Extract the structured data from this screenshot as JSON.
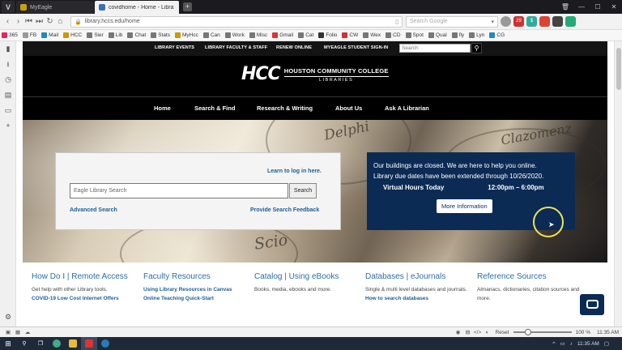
{
  "browser": {
    "tabs": [
      {
        "label": "MyEagle",
        "active": false
      },
      {
        "label": "covidhome - Home - Libra",
        "active": true
      }
    ],
    "url": "library.hccs.edu/home",
    "search_placeholder": "Search Google",
    "bookmarks": [
      "365",
      "FB",
      "Mail",
      "HCC",
      "Sier",
      "Lib",
      "Chat",
      "Stats",
      "MyHcc",
      "Can",
      "Work",
      "Misc",
      "Gmail",
      "Cat",
      "Folio",
      "CW",
      "Wex",
      "CD",
      "Spot",
      "Qual",
      "fly",
      "Lyn",
      "CG"
    ],
    "zoom_reset_label": "Reset",
    "zoom_level": "100 %",
    "status_time": "11:35 AM",
    "taskbar_time": "11:35 AM"
  },
  "site": {
    "utility_links": [
      "LIBRARY EVENTS",
      "LIBRARY FACULTY & STAFF",
      "RENEW ONLINE",
      "MYEAGLE STUDENT SIGN-IN"
    ],
    "utility_search_placeholder": "Search",
    "logo": {
      "mark": "HCC",
      "line1": "HOUSTON COMMUNITY COLLEGE",
      "line2": "LIBRARIES"
    },
    "nav": [
      "Home",
      "Search & Find",
      "Research & Writing",
      "About Us",
      "Ask A Librarian"
    ],
    "search": {
      "learn_link": "Learn to log in here.",
      "input_value": "Eagle Library Search",
      "button_label": "Search",
      "advanced_link": "Advanced Search",
      "feedback_link": "Provide Search Feedback"
    },
    "notice": {
      "line1": "Our buildings are closed.  We are here to help you online.",
      "line2": "Library due dates have been extended through 10/26/2020.",
      "hours_label": "Virtual Hours Today",
      "hours_value": "12:00pm – 6:00pm",
      "button_label": "More Information"
    },
    "hero_map_words": [
      "Delphi",
      "Scio",
      "Clazomenz"
    ],
    "cards": [
      {
        "title": "How Do I | Remote Access",
        "desc": "Get help with other Library tools.",
        "links": [
          "COVID-19 Low Cost Internet Offers"
        ]
      },
      {
        "title": "Faculty Resources",
        "desc": "",
        "links": [
          "Using Library Resources in Canvas",
          "Online Teaching Quick-Start"
        ]
      },
      {
        "title": "Catalog | Using eBooks",
        "desc": "Books, media, ebooks and more.",
        "links": []
      },
      {
        "title": "Databases | eJournals",
        "desc": "Single & multi level databases and journals.",
        "links": [
          "How to search databases"
        ]
      },
      {
        "title": "Reference Sources",
        "desc": "Almanacs, dictionaries, citation sources and more.",
        "links": []
      }
    ]
  },
  "colors": {
    "brand_navy": "#0b2b55",
    "link_blue": "#1a5e97",
    "header_black": "#000000"
  }
}
